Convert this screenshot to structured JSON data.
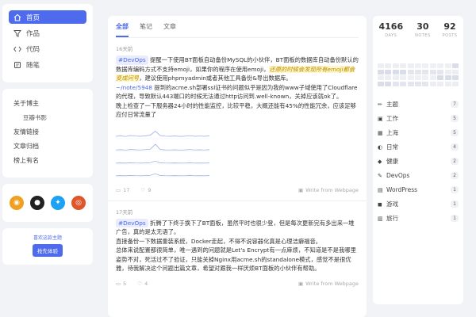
{
  "nav": [
    {
      "label": "首页",
      "icon": "home-icon",
      "active": true
    },
    {
      "label": "作品",
      "icon": "filter-icon",
      "active": false
    },
    {
      "label": "代码",
      "icon": "code-icon",
      "active": false
    },
    {
      "label": "随笔",
      "icon": "note-icon",
      "active": false
    }
  ],
  "links": [
    {
      "label": "关于博主",
      "sub": false
    },
    {
      "label": "豆瓣书影",
      "sub": true
    },
    {
      "label": "友情链接",
      "sub": false
    },
    {
      "label": "文章归档",
      "sub": false
    },
    {
      "label": "榜上有名",
      "sub": false
    }
  ],
  "social": [
    {
      "icon": "rss-icon",
      "glyph": "◉",
      "color": "#f0a020"
    },
    {
      "icon": "github-icon",
      "glyph": "●",
      "color": "#222222"
    },
    {
      "icon": "twitter-icon",
      "glyph": "✦",
      "color": "#1da1f2"
    },
    {
      "icon": "weibo-icon",
      "glyph": "◎",
      "color": "#e0562b"
    }
  ],
  "theme": {
    "text": "喜欢这款主题",
    "button": "抢先体验"
  },
  "tabs": [
    "全部",
    "笔记",
    "文章"
  ],
  "posts": [
    {
      "time": "16天前",
      "tag": "#DevOps",
      "p1a": "提醒一下使用BT面板自动备份MySQL的小伙伴，BT面板的数据库自动备份默认的数据库编码方式不支持emoji，如果你的程序在使用emoji，",
      "p1hl": "还原的时候会发现所有emoji都会变成问号",
      "p1b": "，建议使用phpmyadmin或者其他工具备份&导出数据库。",
      "p2link": "~/note/5948",
      "p2": " 提到的acme.sh部署ssl证书的问题似乎是因为我的www子域使用了Cloudflare的代理，导致默认443端口的时候无法通过http访问到.well-known，关掉应该就ok了。",
      "p3": "晚上检查了一下服务器24小时的性能监控，比较平稳，大概还能有45%的性能冗余，应该足够应付日常流量了",
      "comments": "17",
      "likes": "9",
      "source": "Write from Webpage"
    },
    {
      "time": "17天前",
      "tag": "#DevOps",
      "p1a": "折腾了下终于换下了BT面板，虽然平时也很少登，但是每次更新完有多出来一堆广告，真的是太无语了。",
      "p2": "直接备份一下数据重装系统，Docker走起，不得不说容器化真是心理洁癖福音。",
      "p3": "总体来说配置都很简单，唯一遇到的问题就是Let's Encrypt有一点麻烦，不知道是不是我哪里姿势不对，死活过不了验证，只能关掉Nginx用acme.sh的standalone模式，感觉不是很优雅，待我解决这个问题出篇文章，希望对跟我一样厌烦BT面板的小伙伴有帮助。",
      "comments": "5",
      "likes": "4",
      "source": "Write from Webpage"
    }
  ],
  "chart_values": [
    0.3,
    0.35,
    0.28,
    0.4,
    0.33,
    0.3,
    0.36,
    0.45,
    0.95,
    0.4,
    0.32,
    0.3,
    0.34,
    0.29,
    0.31,
    0.38,
    0.3,
    0.33,
    0.3,
    0.35
  ],
  "stats": [
    {
      "value": "4166",
      "label": "DAYS"
    },
    {
      "value": "30",
      "label": "NOTES"
    },
    {
      "value": "92",
      "label": "POSTS"
    }
  ],
  "categories": [
    {
      "emoji": "✏",
      "name": "主题",
      "count": "7"
    },
    {
      "emoji": "▣",
      "name": "工作",
      "count": "5"
    },
    {
      "emoji": "▦",
      "name": "上海",
      "count": "5"
    },
    {
      "emoji": "◐",
      "name": "日常",
      "count": "4"
    },
    {
      "emoji": "◆",
      "name": "健康",
      "count": "2"
    },
    {
      "emoji": "✎",
      "name": "DevOps",
      "count": "2"
    },
    {
      "emoji": "▤",
      "name": "WordPress",
      "count": "1"
    },
    {
      "emoji": "◼",
      "name": "游戏",
      "count": "1"
    },
    {
      "emoji": "▥",
      "name": "旅行",
      "count": "1"
    }
  ],
  "colors": {
    "accent": "#4f6bed"
  }
}
